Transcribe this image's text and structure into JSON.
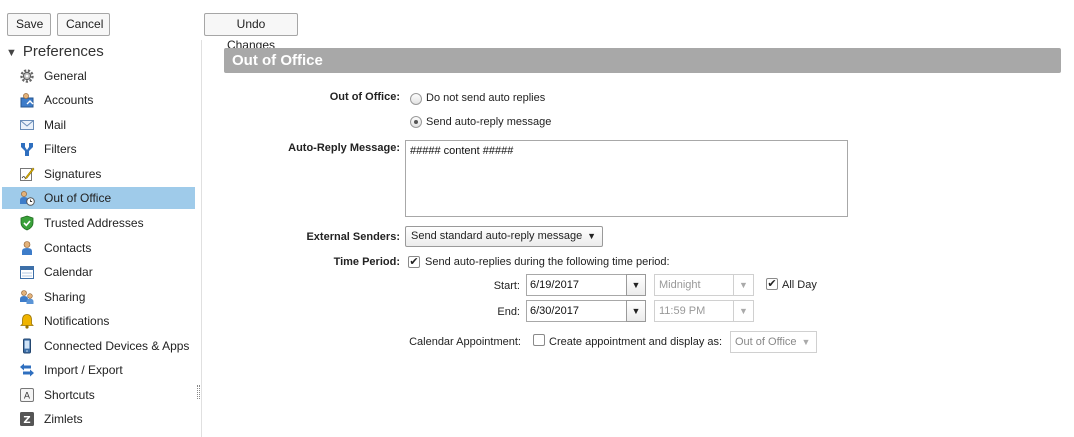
{
  "toolbar": {
    "save_label": "Save",
    "cancel_label": "Cancel",
    "undo_label": "Undo Changes"
  },
  "sidebar": {
    "title": "Preferences",
    "items": [
      {
        "label": "General",
        "icon": "gear-icon"
      },
      {
        "label": "Accounts",
        "icon": "accounts-icon"
      },
      {
        "label": "Mail",
        "icon": "mail-icon"
      },
      {
        "label": "Filters",
        "icon": "filter-icon"
      },
      {
        "label": "Signatures",
        "icon": "signature-icon"
      },
      {
        "label": "Out of Office",
        "icon": "out-of-office-icon",
        "selected": true
      },
      {
        "label": "Trusted Addresses",
        "icon": "shield-check-icon"
      },
      {
        "label": "Contacts",
        "icon": "contact-icon"
      },
      {
        "label": "Calendar",
        "icon": "calendar-icon"
      },
      {
        "label": "Sharing",
        "icon": "sharing-icon"
      },
      {
        "label": "Notifications",
        "icon": "bell-icon"
      },
      {
        "label": "Connected Devices & Apps",
        "icon": "mobile-device-icon"
      },
      {
        "label": "Import / Export",
        "icon": "import-export-icon"
      },
      {
        "label": "Shortcuts",
        "icon": "keyboard-icon"
      },
      {
        "label": "Zimlets",
        "icon": "zimlet-icon"
      }
    ]
  },
  "section": {
    "title": "Out of Office"
  },
  "form": {
    "ooo_label": "Out of Office:",
    "radio_no_reply": "Do not send auto replies",
    "radio_send_reply": "Send auto-reply message",
    "auto_reply_label": "Auto-Reply Message:",
    "auto_reply_value": "##### content  #####",
    "external_label": "External Senders:",
    "external_value": "Send standard auto-reply message",
    "time_period_label": "Time Period:",
    "time_period_checkbox": "Send auto-replies during the following time period:",
    "start_label": "Start:",
    "start_date": "6/19/2017",
    "start_time": "Midnight",
    "all_day_label": "All Day",
    "end_label": "End:",
    "end_date": "6/30/2017",
    "end_time": "11:59 PM",
    "calendar_label": "Calendar Appointment:",
    "calendar_checkbox": "Create appointment and display as:",
    "calendar_value": "Out of Office"
  },
  "colors": {
    "selected_row": "#9fcbea",
    "section_bar": "#a8a8a8"
  }
}
